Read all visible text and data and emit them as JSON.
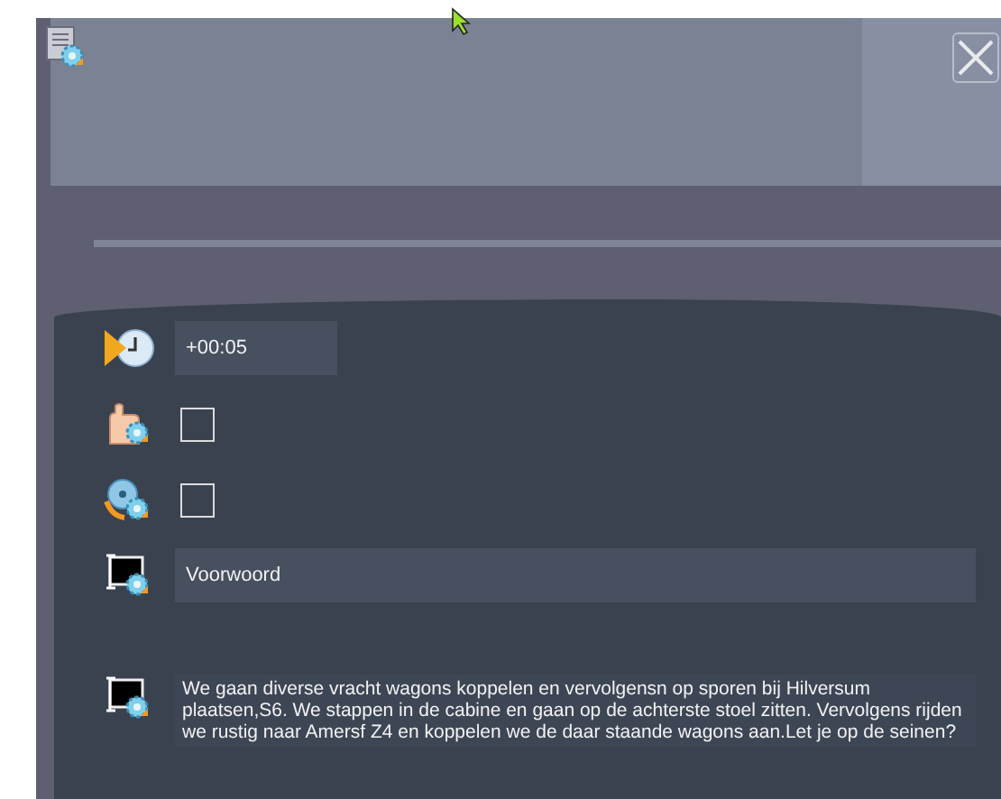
{
  "rows": [
    {
      "kind": "time",
      "value": "+00:05"
    },
    {
      "kind": "hand_toggle",
      "checked": false
    },
    {
      "kind": "disc_toggle",
      "checked": false
    },
    {
      "kind": "title",
      "value": "Voorwoord"
    },
    {
      "kind": "text",
      "value": "We gaan diverse vracht wagons koppelen en vervolgensn op sporen bij Hilversum plaatsen,S6. We stappen in de cabine en gaan op de achterste stoel zitten. Vervolgens rijden we rustig naar Amersf Z4 en koppelen we de daar staande wagons aan.Let je op de seinen?"
    }
  ]
}
